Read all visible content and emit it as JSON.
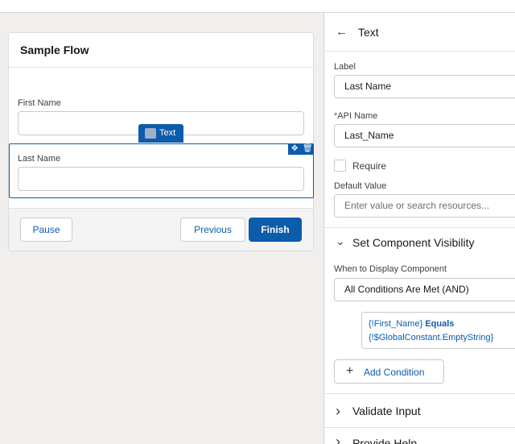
{
  "screen": {
    "title": "Sample Flow",
    "first_name_label": "First Name",
    "last_name_label": "Last Name",
    "component_tag": "Text",
    "move_icon_glyph": "✥",
    "delete_icon_glyph": "🗑",
    "pause_label": "Pause",
    "previous_label": "Previous",
    "finish_label": "Finish"
  },
  "panel": {
    "back_glyph": "←",
    "title": "Text",
    "label_label": "Label",
    "label_value": "Last Name",
    "required_marker": "*",
    "api_name_label": "API Name",
    "api_name_value": "Last_Name",
    "require_label": "Require",
    "default_value_label": "Default Value",
    "default_value_placeholder": "Enter value or search resources...",
    "visibility": {
      "chevron": "⌄",
      "title": "Set Component Visibility",
      "when_label": "When to Display Component",
      "when_value": "All Conditions Are Met (AND)",
      "condition_left": "{!First_Name}",
      "condition_op": "Equals",
      "condition_right": "{!$GlobalConstant.EmptyString}",
      "add_glyph": "+",
      "add_label": "Add Condition"
    },
    "validate": {
      "chevron": "›",
      "title": "Validate Input"
    },
    "help": {
      "chevron": "›",
      "title": "Provide Help"
    }
  },
  "colors": {
    "brand": "#0b5cab",
    "canvas_bg": "#f0efee"
  }
}
